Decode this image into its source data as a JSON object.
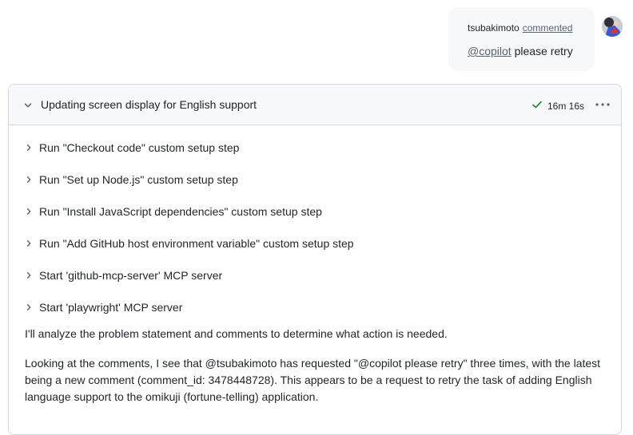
{
  "comment": {
    "author": "tsubakimoto",
    "action": "commented",
    "mention": "@copilot",
    "text": "please retry"
  },
  "session": {
    "title": "Updating screen display for English support",
    "duration": "16m 16s",
    "status_color": "#1a7f37",
    "steps": [
      {
        "label": "Run \"Checkout code\" custom setup step"
      },
      {
        "label": "Run \"Set up Node.js\" custom setup step"
      },
      {
        "label": "Run \"Install JavaScript dependencies\" custom setup step"
      },
      {
        "label": "Run \"Add GitHub host environment variable\" custom setup step"
      },
      {
        "label": "Start 'github-mcp-server' MCP server"
      },
      {
        "label": "Start 'playwright' MCP server"
      }
    ],
    "paragraphs": [
      "I'll analyze the problem statement and comments to determine what action is needed.",
      "Looking at the comments, I see that @tsubakimoto has requested \"@copilot please retry\" three times, with the latest being a new comment (comment_id: 3478448728). This appears to be a request to retry the task of adding English language support to the omikuji (fortune-telling) application."
    ]
  }
}
